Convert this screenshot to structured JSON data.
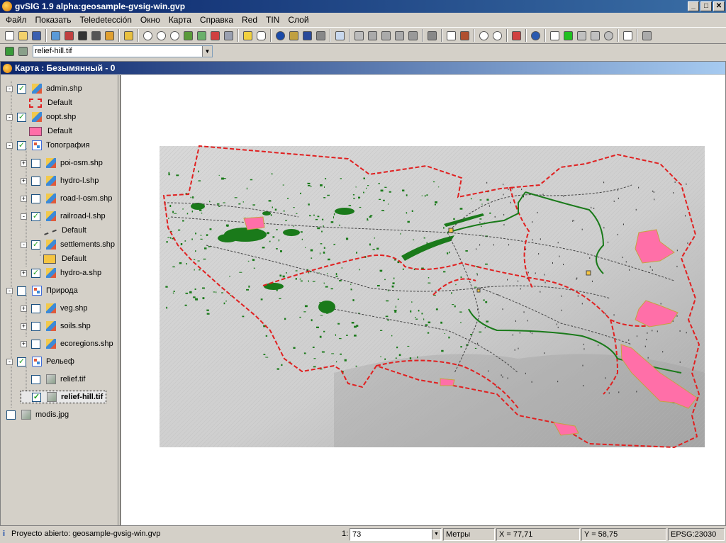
{
  "window": {
    "title": "gvSIG 1.9 alpha:geosample-gvsig-win.gvp",
    "min": "_",
    "max": "□",
    "close": "✕"
  },
  "menu": [
    "Файл",
    "Показать",
    "Teledetección",
    "Окно",
    "Карта",
    "Справка",
    "Red",
    "TIN",
    "Слой"
  ],
  "toolbar2": {
    "layer_select": "relief-hill.tif"
  },
  "mapwindow": {
    "title": "Карта : Безымянный - 0"
  },
  "toc": {
    "items": [
      {
        "label": "admin.shp",
        "checked": true,
        "kind": "vec"
      },
      {
        "label": "Default"
      },
      {
        "label": "oopt.shp",
        "checked": true,
        "kind": "vec"
      },
      {
        "label": "Default"
      },
      {
        "label": "Топография",
        "checked": true,
        "kind": "grp"
      },
      {
        "label": "poi-osm.shp",
        "checked": false,
        "kind": "vec"
      },
      {
        "label": "hydro-l.shp",
        "checked": false,
        "kind": "vec"
      },
      {
        "label": "road-l-osm.shp",
        "checked": false,
        "kind": "vec"
      },
      {
        "label": "railroad-l.shp",
        "checked": true,
        "kind": "vec"
      },
      {
        "label": "Default"
      },
      {
        "label": "settlements.shp",
        "checked": true,
        "kind": "vec"
      },
      {
        "label": "Default"
      },
      {
        "label": "hydro-a.shp",
        "checked": true,
        "kind": "vec"
      },
      {
        "label": "Природа",
        "checked": false,
        "kind": "grp"
      },
      {
        "label": "veg.shp",
        "checked": false,
        "kind": "vec"
      },
      {
        "label": "soils.shp",
        "checked": false,
        "kind": "vec"
      },
      {
        "label": "ecoregions.shp",
        "checked": false,
        "kind": "vec"
      },
      {
        "label": "Рельеф",
        "checked": true,
        "kind": "grp"
      },
      {
        "label": "relief.tif",
        "checked": false,
        "kind": "ras"
      },
      {
        "label": "relief-hill.tif",
        "checked": true,
        "kind": "ras"
      },
      {
        "label": "modis.jpg",
        "checked": false,
        "kind": "ras"
      }
    ]
  },
  "colors": {
    "admin_border": "#e02020",
    "oopt_fill": "#ff6fa8",
    "settlements_fill": "#f5c542",
    "hydro": "#1a7a1a",
    "railroad": "#444444"
  },
  "status": {
    "message": "Proyecto abierto: geosample-gvsig-win.gvp",
    "scale_prefix": "1:",
    "scale": "73",
    "units": "Метры",
    "x": "X = 77,71",
    "y": "Y = 58,75",
    "epsg": "EPSG:23030"
  }
}
